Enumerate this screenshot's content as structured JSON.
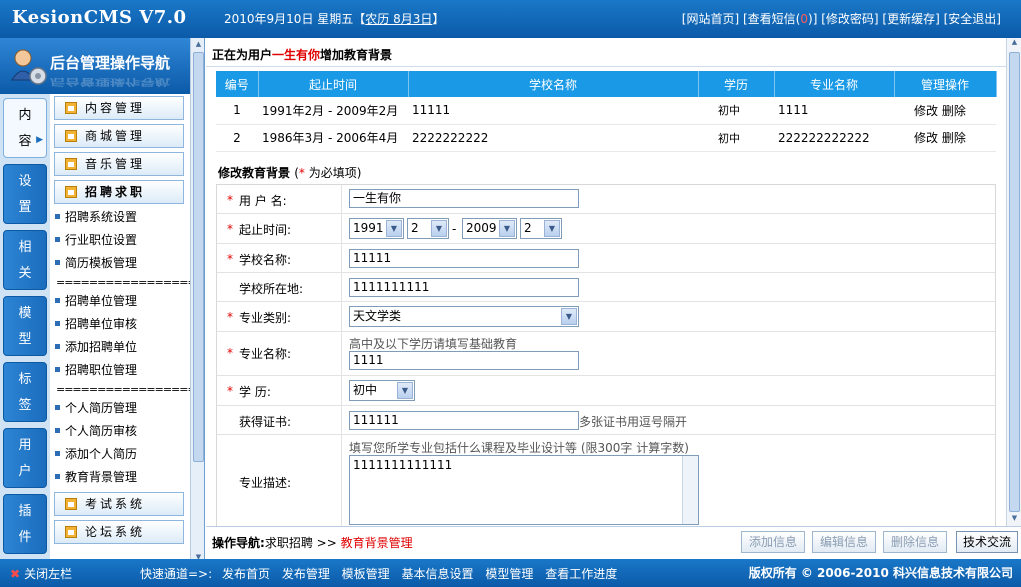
{
  "app": {
    "brand": "KesionCMS V7.0",
    "date": "2010年9月10日 星期五【",
    "lunar": "农历 8月3日",
    "date_end": "】"
  },
  "toplinks": {
    "home": "[网站首页]",
    "sms_prefix": "[查看短信(",
    "sms_count": "0",
    "sms_suffix": ")]",
    "password": "[修改密码]",
    "cache": "[更新缓存]",
    "logout": "[安全退出]"
  },
  "sidebar": {
    "title": "后台管理操作导航",
    "tabs": [
      "内容",
      "设置",
      "相关",
      "模型",
      "标签",
      "用户",
      "插件"
    ],
    "menu_buttons": [
      "内容管理",
      "商城管理",
      "音乐管理",
      "招聘求职"
    ],
    "menu_items_a": [
      "招聘系统设置",
      "行业职位设置",
      "简历模板管理"
    ],
    "separator": "==================",
    "menu_items_b": [
      "招聘单位管理",
      "招聘单位审核",
      "添加招聘单位",
      "招聘职位管理"
    ],
    "menu_items_c": [
      "个人简历管理",
      "个人简历审核",
      "添加个人简历",
      "教育背景管理"
    ],
    "menu_buttons_bottom": [
      "考试系统",
      "论坛系统"
    ]
  },
  "main": {
    "title_prefix": "正在为用户",
    "title_user": "一生有你",
    "title_suffix": "增加教育背景",
    "table": {
      "headers": [
        "编号",
        "起止时间",
        "学校名称",
        "学历",
        "专业名称",
        "管理操作"
      ],
      "rows": [
        [
          "1",
          "1991年2月 - 2009年2月",
          "11111",
          "初中",
          "1111",
          "修改",
          "删除"
        ],
        [
          "2",
          "1986年3月 - 2006年4月",
          "2222222222",
          "初中",
          "222222222222",
          "修改",
          "删除"
        ]
      ]
    },
    "form_title": "修改教育背景",
    "form_note_open": "(",
    "form_note_star": "*",
    "form_note_close": " 为必填项)",
    "fields": {
      "username_label": "用 户 名:",
      "username_value": "一生有你",
      "period_label": "起止时间:",
      "start_year": "1991",
      "start_month": "2",
      "period_dash": "-",
      "end_year": "2009",
      "end_month": "2",
      "school_label": "学校名称:",
      "school_value": "11111",
      "location_label": "学校所在地:",
      "location_value": "1111111111",
      "category_label": "专业类别:",
      "category_value": "天文学类",
      "major_label": "专业名称:",
      "major_hint": "高中及以下学历请填写基础教育",
      "major_value": "1111",
      "degree_label": "学 历:",
      "degree_value": "初中",
      "cert_label": "获得证书:",
      "cert_value": "111111",
      "cert_hint": "多张证书用逗号隔开",
      "desc_label": "专业描述:",
      "desc_hint": "填写您所学专业包括什么课程及毕业设计等 (限300字 计算字数)",
      "desc_value": "1111111111111"
    }
  },
  "opbar": {
    "label": "操作导航:",
    "crumb": "求职招聘",
    "sep": ">>",
    "current": "教育背景管理",
    "buttons": [
      "添加信息",
      "编辑信息",
      "删除信息",
      "技术交流"
    ]
  },
  "bottombar": {
    "close": "关闭左栏",
    "quick_label": "快速通道=>:",
    "quick_links": [
      "发布首页",
      "发布管理",
      "模板管理",
      "基本信息设置",
      "模型管理",
      "查看工作进度"
    ],
    "copyright": "版权所有 © 2006-2010 科兴信息技术有限公司"
  },
  "colors": {
    "bar_blue": "#0b5aa8",
    "header_blue": "#1a9ae6",
    "required_red": "#e00000"
  }
}
